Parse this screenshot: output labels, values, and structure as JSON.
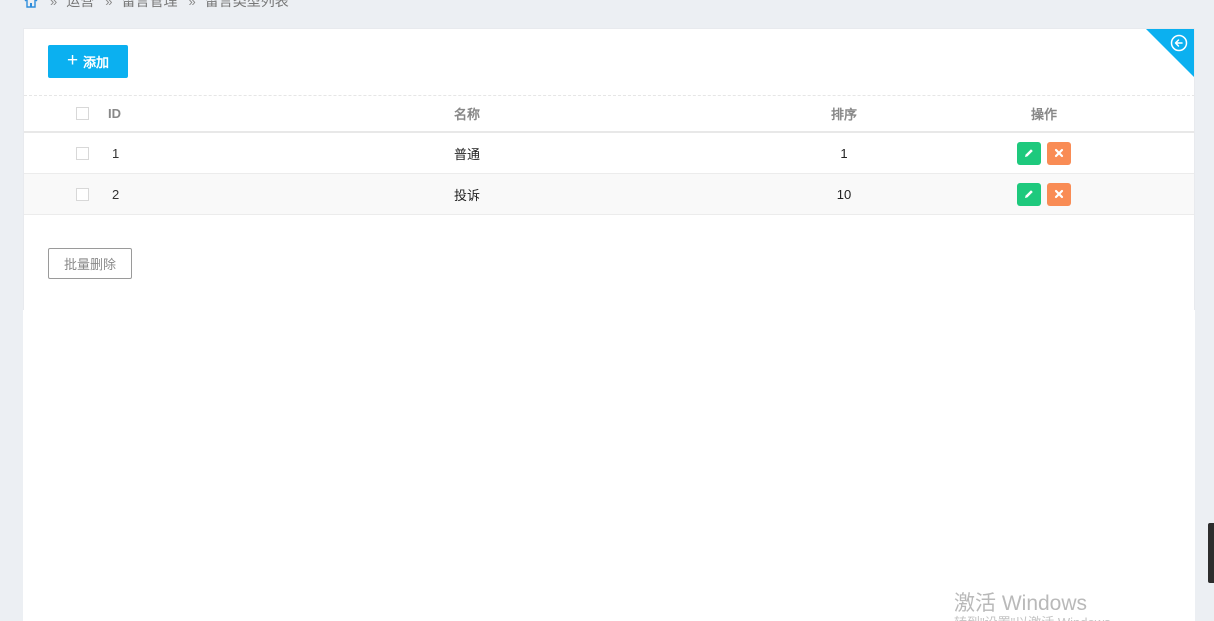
{
  "breadcrumb": {
    "items": [
      "运营",
      "留言管理",
      "留言类型列表"
    ],
    "separator": "»"
  },
  "toolbar": {
    "add_label": "添加",
    "add_icon": "plus-icon"
  },
  "corner": {
    "icon": "back-circle-icon",
    "color": "#0bb0f0"
  },
  "table": {
    "headers": {
      "id": "ID",
      "name": "名称",
      "sort": "排序",
      "operation": "操作"
    },
    "rows": [
      {
        "id": "1",
        "name": "普通",
        "sort": "1"
      },
      {
        "id": "2",
        "name": "投诉",
        "sort": "10"
      }
    ]
  },
  "footer": {
    "batch_delete_label": "批量删除"
  },
  "watermark": {
    "line1": "激活 Windows",
    "line2": "转到\"设置\"以激活 Windows。"
  },
  "colors": {
    "primary": "#0bb0f0",
    "edit": "#1ec97d",
    "delete": "#f98c55"
  }
}
